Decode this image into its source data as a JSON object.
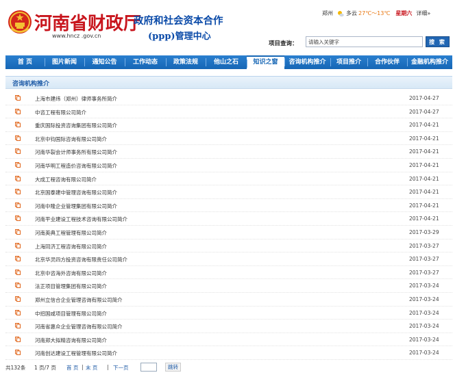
{
  "header": {
    "site_title": "河南省财政厅",
    "site_url": "www.hncz .gov.cn",
    "ppp_title_line1": "政府和社会资本合作",
    "ppp_title_line2": "(ppp)管理中心"
  },
  "weather": {
    "city": "郑州",
    "condition": "多云",
    "temperature": "27℃～13℃",
    "weekday": "星期六",
    "detail_label": "详细»"
  },
  "search": {
    "label": "项目查询：",
    "placeholder": "请输入关键字",
    "button_label": "搜 索"
  },
  "nav": {
    "items": [
      {
        "label": "首  页"
      },
      {
        "label": "图片新闻"
      },
      {
        "label": "通知公告"
      },
      {
        "label": "工作动态"
      },
      {
        "label": "政策法规"
      },
      {
        "label": "他山之石"
      },
      {
        "label": "知识之窗"
      },
      {
        "label": "咨询机构推介"
      },
      {
        "label": "项目推介"
      },
      {
        "label": "合作伙伴"
      },
      {
        "label": "金融机构推介"
      }
    ],
    "active_index": 6
  },
  "section": {
    "title": "咨询机构推介"
  },
  "list": {
    "items": [
      {
        "title": "上海市建纬（郑州）律师事务所简介",
        "date": "2017-04-27"
      },
      {
        "title": "中咨工程有限公司简介",
        "date": "2017-04-27"
      },
      {
        "title": "重庆国际投资咨询集团有限公司简介",
        "date": "2017-04-21"
      },
      {
        "title": "北京中钧国际咨询有限公司简介",
        "date": "2017-04-21"
      },
      {
        "title": "河南华裂会计师事务所有限公司简介",
        "date": "2017-04-21"
      },
      {
        "title": "河南华明工程造价咨询有限公司简介",
        "date": "2017-04-21"
      },
      {
        "title": "大成工程咨询有限公司简介",
        "date": "2017-04-21"
      },
      {
        "title": "北京国泰建中管理咨询有限公司简介",
        "date": "2017-04-21"
      },
      {
        "title": "河南中隆企业管理集团有限公司简介",
        "date": "2017-04-21"
      },
      {
        "title": "河南平业建设工程技术咨询有限公司简介",
        "date": "2017-04-21"
      },
      {
        "title": "河南英典工程管理有限公司简介",
        "date": "2017-03-29"
      },
      {
        "title": "上海同济工程咨询有限公司简介",
        "date": "2017-03-27"
      },
      {
        "title": "北京华灵四方投资咨询有限责任公司简介",
        "date": "2017-03-27"
      },
      {
        "title": "北京中咨海外咨询有限公司简介",
        "date": "2017-03-27"
      },
      {
        "title": "法正项目管理集团有限公司简介",
        "date": "2017-03-24"
      },
      {
        "title": "郑州立信合企业管理咨询有限公司简介",
        "date": "2017-03-24"
      },
      {
        "title": "中招国咸项目管理有限公司简介",
        "date": "2017-03-24"
      },
      {
        "title": "河南省惠众企业管理咨询有限公司简介",
        "date": "2017-03-24"
      },
      {
        "title": "河南郑大拟精咨询有限公司简介",
        "date": "2017-03-24"
      },
      {
        "title": "河南创达建设工程管理有限公司简介",
        "date": "2017-03-24"
      }
    ]
  },
  "pager": {
    "total": "共132条",
    "page_info": "1 页/7 页",
    "first_label": "首 页",
    "separator": "|",
    "prev_label": "末 页",
    "next_label": "下一页",
    "jump_label": "跳转"
  },
  "colors": {
    "brand_red": "#c8151d",
    "brand_blue": "#1666b5",
    "title_blue": "#0a4aa8",
    "bullet_orange": "#e0651a"
  }
}
